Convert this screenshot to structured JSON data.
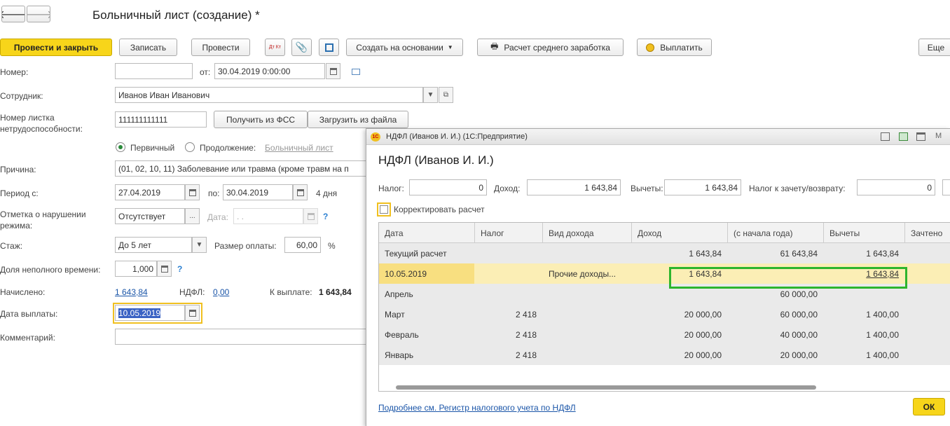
{
  "nav": {
    "back": "🡐",
    "forward": "🡒"
  },
  "doc_title": "Больничный лист (создание) *",
  "toolbar": {
    "post_close": "Провести и закрыть",
    "save": "Записать",
    "post": "Провести",
    "dtkt": "Дт Кт",
    "create_basis": "Создать на основании",
    "avg_earnings": "Расчет среднего заработка",
    "pay": "Выплатить",
    "more": "Еще"
  },
  "form": {
    "number_label": "Номер:",
    "number_value": "",
    "from_label": "от:",
    "date_value": "30.04.2019  0:00:00",
    "employee_label": "Сотрудник:",
    "employee_value": "Иванов Иван Иванович",
    "sheet_label": "Номер листка нетрудоспособности:",
    "sheet_value": "111111111111",
    "get_fss": "Получить из ФСС",
    "load_file": "Загрузить из файла",
    "primary_label": "Первичный",
    "continuation_label": "Продолжение:",
    "continuation_link": "Больничный лист",
    "reason_label": "Причина:",
    "reason_value": "(01, 02, 10, 11) Заболевание или травма (кроме травм на п",
    "period_label": "Период с:",
    "period_from": "27.04.2019",
    "period_to_label": "по:",
    "period_to": "30.04.2019",
    "days": "4 дня",
    "violation_label": "Отметка о нарушении режима:",
    "violation_value": "Отсутствует",
    "violation_date_label": "Дата:",
    "violation_date": "  .  .",
    "tenure_label": "Стаж:",
    "tenure_value": "До 5 лет",
    "pay_size_label": "Размер оплаты:",
    "pay_size_value": "60,00",
    "percent": "%",
    "parttime_label": "Доля неполного времени:",
    "parttime_value": "1,000",
    "accrued_label": "Начислено:",
    "accrued_value": "1 643,84",
    "ndfl_label": "НДФЛ:",
    "ndfl_value": "0,00",
    "topay_label": "К выплате:",
    "topay_value": "1 643,84",
    "paydate_label": "Дата выплаты:",
    "paydate_value": "10.05.2019",
    "comment_label": "Комментарий:",
    "comment_value": ""
  },
  "dialog": {
    "window_title": "НДФЛ (Иванов И. И.)  (1С:Предприятие)",
    "heading": "НДФЛ (Иванов И. И.)",
    "tax_label": "Налог:",
    "tax_value": "0",
    "income_label": "Доход:",
    "income_value": "1 643,84",
    "deductions_label": "Вычеты:",
    "deductions_value": "1 643,84",
    "offset_label": "Налог к зачету/возврату:",
    "offset_value": "0",
    "correct_label": "Корректировать расчет",
    "columns": [
      "Дата",
      "Налог",
      "Вид дохода",
      "Доход",
      "(с начала года)",
      "Вычеты",
      "Зачтено"
    ],
    "rows": [
      {
        "date": "Текущий расчет",
        "tax": "",
        "kind": "",
        "income": "1 643,84",
        "ytd": "61 643,84",
        "ded": "1 643,84"
      },
      {
        "date": "10.05.2019",
        "tax": "",
        "kind": "Прочие доходы...",
        "income": "1 643,84",
        "ytd": "",
        "ded": "1 643,84"
      },
      {
        "date": "Апрель",
        "tax": "",
        "kind": "",
        "income": "",
        "ytd": "60 000,00",
        "ded": ""
      },
      {
        "date": "Март",
        "tax": "2 418",
        "kind": "",
        "income": "20 000,00",
        "ytd": "60 000,00",
        "ded": "1 400,00"
      },
      {
        "date": "Февраль",
        "tax": "2 418",
        "kind": "",
        "income": "20 000,00",
        "ytd": "40 000,00",
        "ded": "1 400,00"
      },
      {
        "date": "Январь",
        "tax": "2 418",
        "kind": "",
        "income": "20 000,00",
        "ytd": "20 000,00",
        "ded": "1 400,00"
      }
    ],
    "footer_link": "Подробнее см. Регистр налогового учета по НДФЛ",
    "ok": "ОК"
  },
  "colors": {
    "accent_yellow": "#f7d51a",
    "highlight": "#2db52d",
    "link": "#1a55a8"
  }
}
